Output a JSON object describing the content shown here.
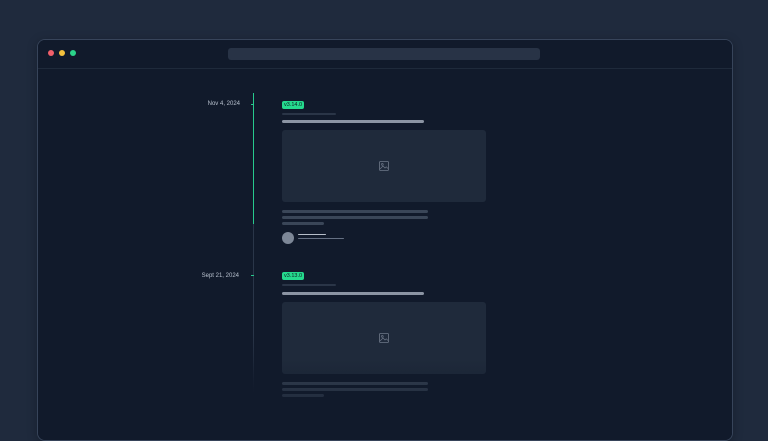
{
  "window": {
    "title_dots": [
      "close",
      "minimize",
      "zoom"
    ]
  },
  "timeline": {
    "entries": [
      {
        "date": "Nov 4, 2024",
        "version": "v3.14.0",
        "has_image": true,
        "has_author": true
      },
      {
        "date": "Sept 21, 2024",
        "version": "v3.13.0",
        "has_image": true,
        "has_author": false
      }
    ]
  },
  "colors": {
    "accent": "#25d98e",
    "background": "#1f2a3d",
    "window": "#111a2b",
    "placeholder": "#1f2a3b"
  },
  "icons": {
    "image_placeholder": "image-icon"
  }
}
